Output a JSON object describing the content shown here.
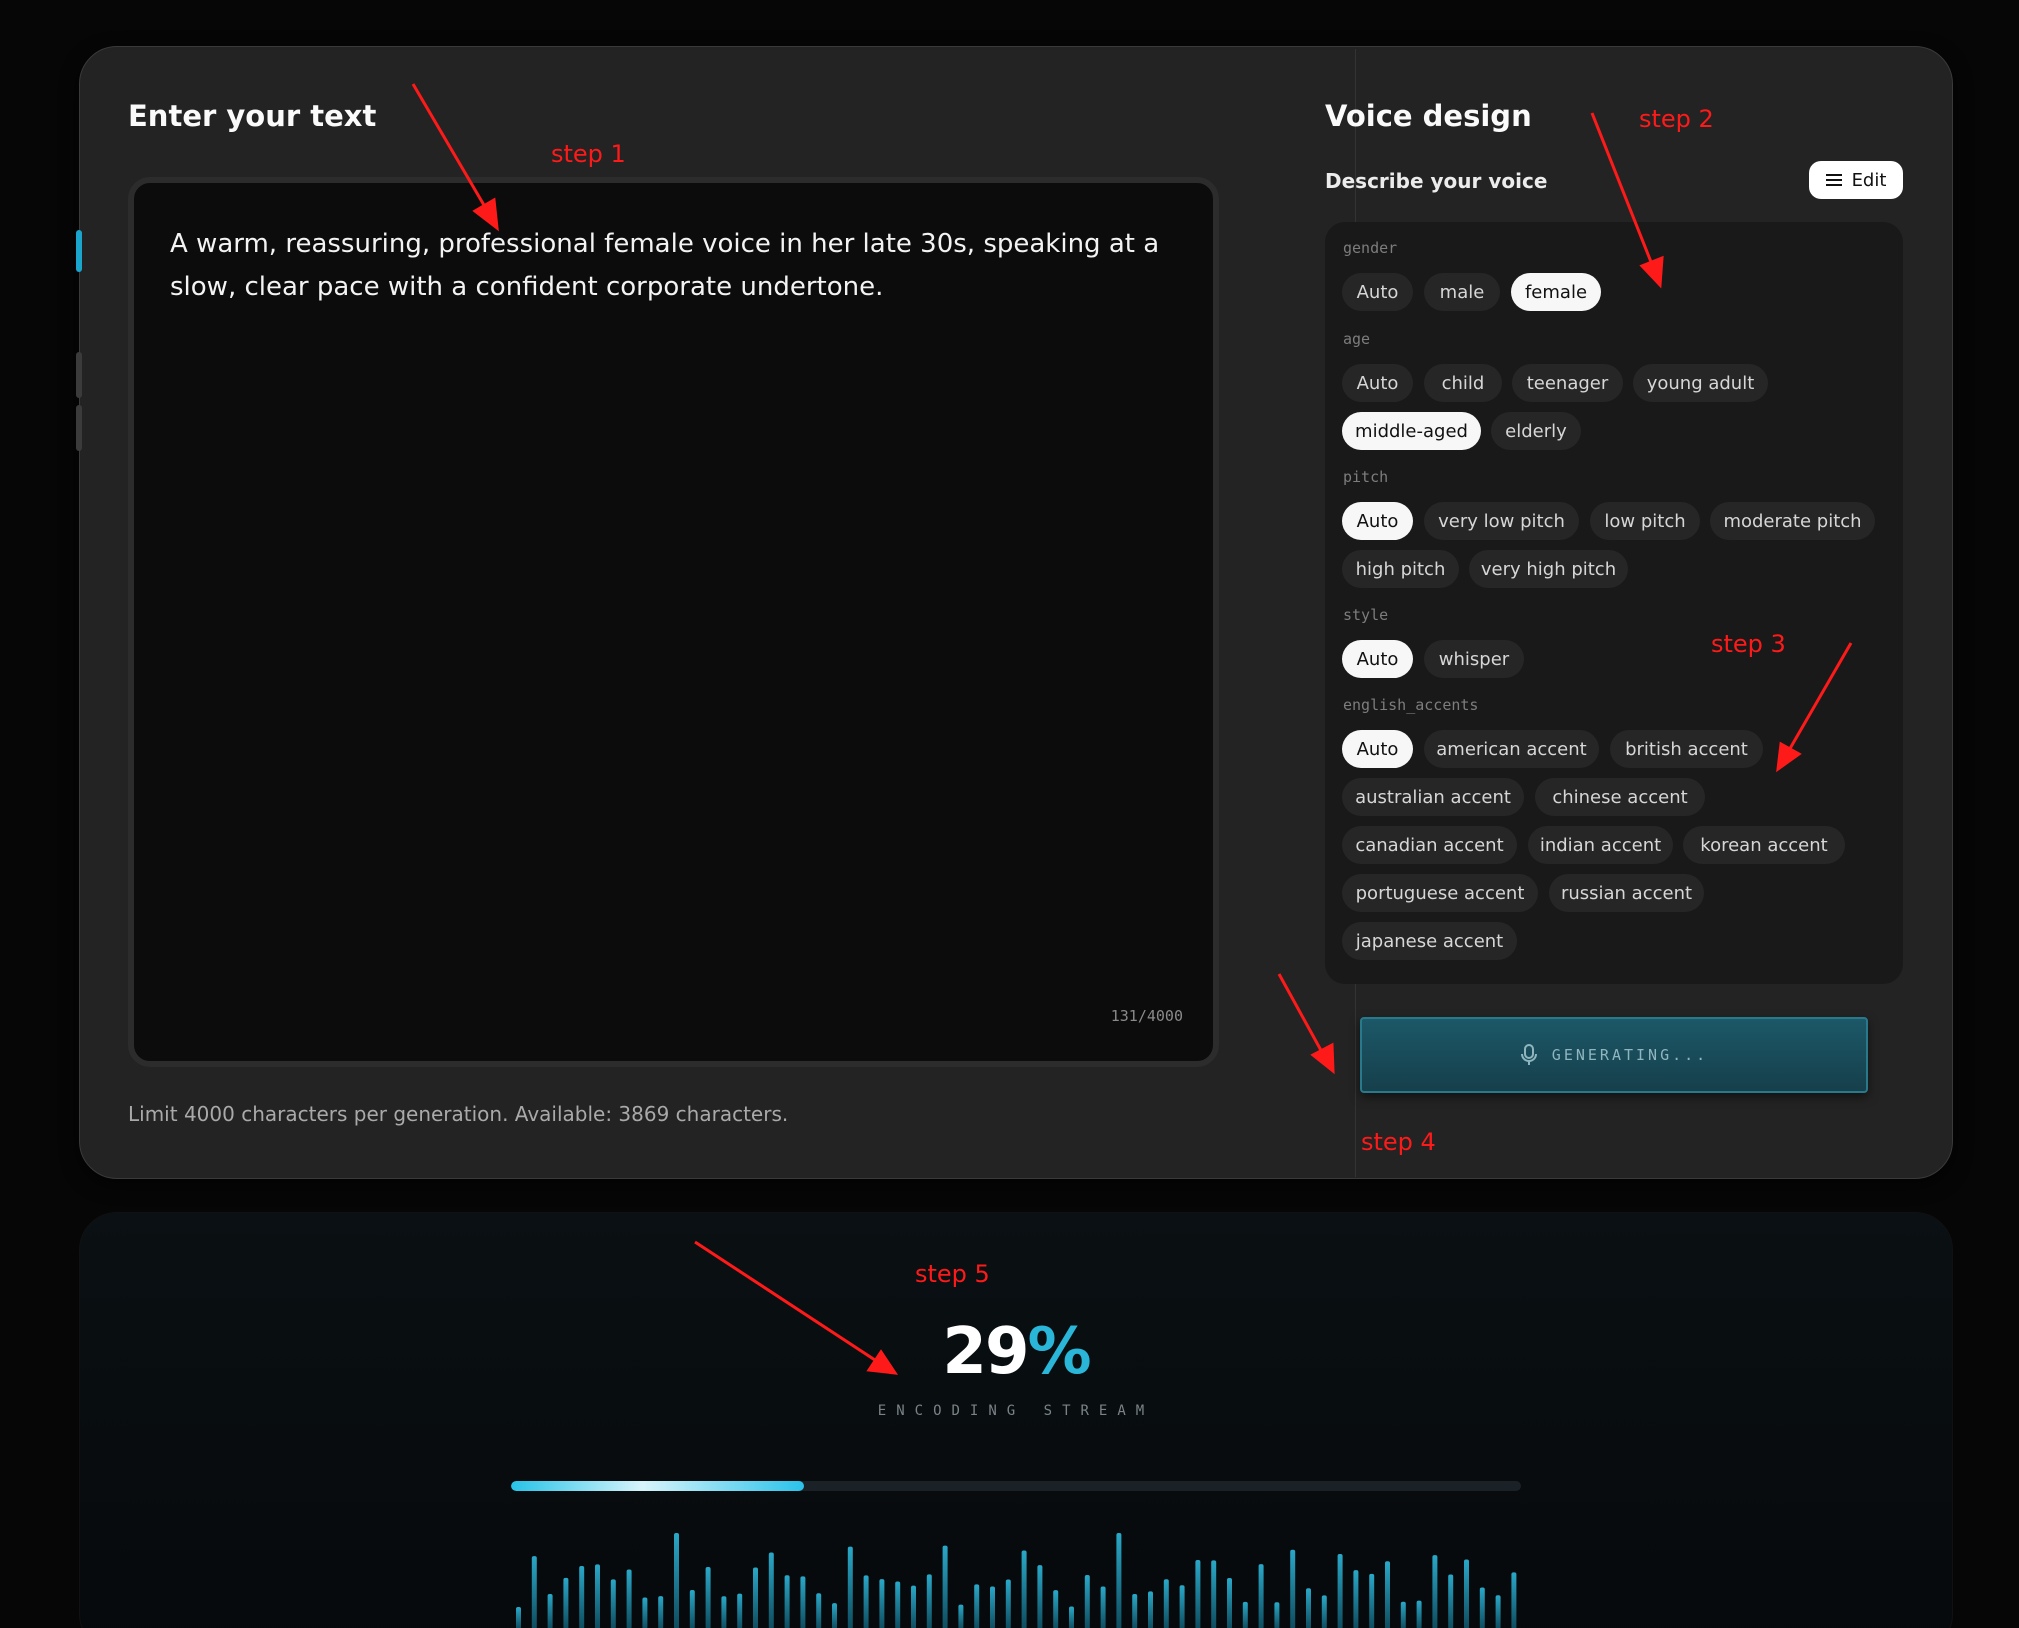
{
  "left": {
    "title": "Enter your text",
    "text": "A warm, reassuring, professional female voice in her late 30s, speaking at a slow, clear pace with a confident corporate undertone.",
    "counter": "131/4000",
    "limit_note": "Limit 4000 characters per generation. Available: 3869 characters."
  },
  "right": {
    "title": "Voice design",
    "subtitle": "Describe your voice",
    "edit_label": "Edit",
    "groups": [
      {
        "label": "gender",
        "options": [
          "Auto",
          "male",
          "female"
        ],
        "selected": "female"
      },
      {
        "label": "age",
        "options": [
          "Auto",
          "child",
          "teenager",
          "young adult",
          "middle-aged",
          "elderly"
        ],
        "selected": "middle-aged"
      },
      {
        "label": "pitch",
        "options": [
          "Auto",
          "very low pitch",
          "low pitch",
          "moderate pitch",
          "high pitch",
          "very high pitch"
        ],
        "selected": "Auto"
      },
      {
        "label": "style",
        "options": [
          "Auto",
          "whisper"
        ],
        "selected": "Auto"
      },
      {
        "label": "english_accents",
        "options": [
          "Auto",
          "american accent",
          "british accent",
          "australian accent",
          "chinese accent",
          "canadian accent",
          "indian accent",
          "korean accent",
          "portuguese accent",
          "russian accent",
          "japanese accent"
        ],
        "selected": "Auto"
      }
    ],
    "generate_label": "GENERATING..."
  },
  "progress": {
    "number": "29",
    "symbol": "%",
    "value": 0.29,
    "status": "ENCODING STREAM",
    "accent": "#29b6d8"
  },
  "annotations": [
    "step 1",
    "step 2",
    "step 3",
    "step 4",
    "step 5"
  ],
  "icons": [
    "menu-icon",
    "microphone-icon"
  ]
}
